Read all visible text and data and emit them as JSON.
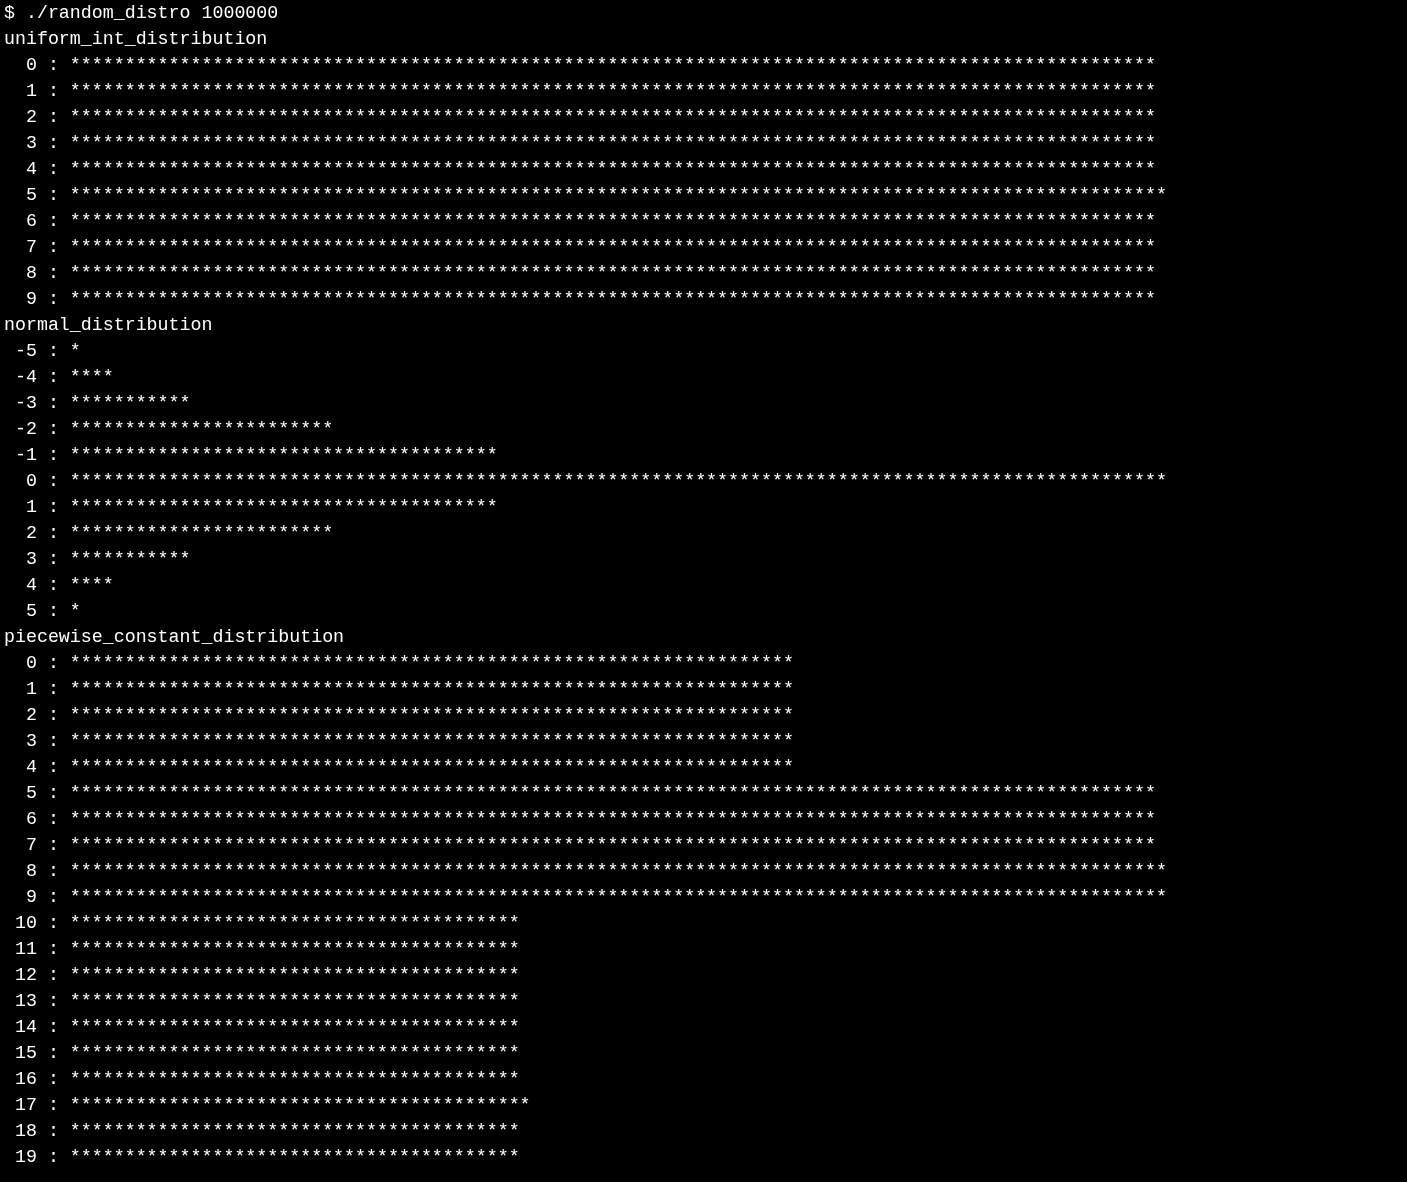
{
  "terminal": {
    "command": "$ ./random_distro 1000000",
    "sections": [
      {
        "title": "uniform_int_distribution",
        "lines": [
          "  0 : ***************************************************************************************************",
          "  1 : ***************************************************************************************************",
          "  2 : ***************************************************************************************************",
          "  3 : ***************************************************************************************************",
          "  4 : ***************************************************************************************************",
          "  5 : ****************************************************************************************************",
          "  6 : ***************************************************************************************************",
          "  7 : ***************************************************************************************************",
          "  8 : ***************************************************************************************************",
          "  9 : ***************************************************************************************************"
        ]
      },
      {
        "title": "normal_distribution",
        "lines": [
          " -5 : *",
          " -4 : ****",
          " -3 : ***********",
          " -2 : ************************",
          " -1 : ***************************************",
          "  0 : ****************************************************************************************************",
          "  1 : ***************************************",
          "  2 : ************************",
          "  3 : ***********",
          "  4 : ****",
          "  5 : *"
        ]
      },
      {
        "title": "piecewise_constant_distribution",
        "lines": [
          "  0 : ******************************************************************",
          "  1 : ******************************************************************",
          "  2 : ******************************************************************",
          "  3 : ******************************************************************",
          "  4 : ******************************************************************",
          "  5 : ***************************************************************************************************",
          "  6 : ***************************************************************************************************",
          "  7 : ***************************************************************************************************",
          "  8 : ****************************************************************************************************",
          "  9 : ****************************************************************************************************",
          " 10 : *****************************************",
          " 11 : *****************************************",
          " 12 : *****************************************",
          " 13 : *****************************************",
          " 14 : *****************************************",
          " 15 : *****************************************",
          " 16 : *****************************************",
          " 17 : ******************************************",
          " 18 : *****************************************",
          " 19 : *****************************************"
        ]
      }
    ]
  }
}
